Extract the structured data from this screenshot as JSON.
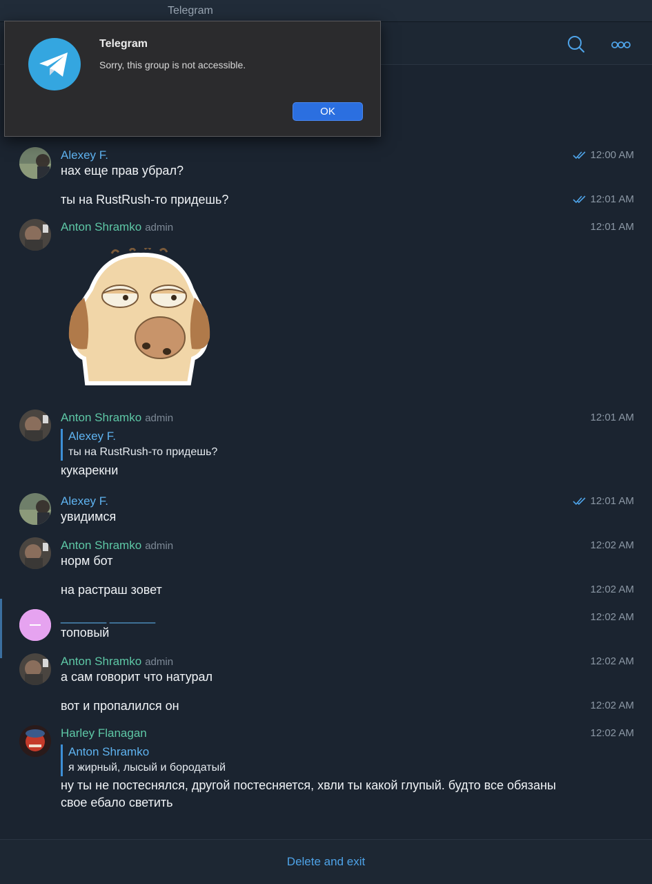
{
  "window": {
    "title": "Telegram"
  },
  "dialog": {
    "title": "Telegram",
    "message": "Sorry, this group is not accessible.",
    "ok_label": "OK"
  },
  "messages": [
    {
      "author": "Alexey F.",
      "text": "нах еще прав убрал?",
      "time": "12:00 AM",
      "read": true
    },
    {
      "text": "ты на RustRush-то придешь?",
      "time": "12:01 AM",
      "read": true
    },
    {
      "author": "Anton Shramko",
      "badge": "admin",
      "time": "12:01 AM",
      "sticker": "dog-sticker"
    },
    {
      "author": "Anton Shramko",
      "badge": "admin",
      "time": "12:01 AM",
      "reply": {
        "author": "Alexey F.",
        "text": "ты на RustRush-то придешь?"
      },
      "text": "кукарекни"
    },
    {
      "author": "Alexey F.",
      "text": "увидимся",
      "time": "12:01 AM",
      "read": true
    },
    {
      "author": "Anton Shramko",
      "badge": "admin",
      "text": "норм бот",
      "time": "12:02 AM"
    },
    {
      "text": "на растраш зовет",
      "time": "12:02 AM"
    },
    {
      "author": "_______ _______",
      "text": "топовый",
      "time": "12:02 AM"
    },
    {
      "author": "Anton Shramko",
      "badge": "admin",
      "text": "а сам говорит что натурал",
      "time": "12:02 AM"
    },
    {
      "text": "вот и пропалился он",
      "time": "12:02 AM"
    },
    {
      "author": "Harley Flanagan",
      "time": "12:02 AM",
      "reply": {
        "author": "Anton Shramko",
        "text": "я жирный, лысый и бородатый"
      },
      "text": "ну ты не постеснялся, другой постесняется, хвли ты какой глупый. будто все обязаны свое ебало светить"
    }
  ],
  "footer": {
    "action_label": "Delete and exit"
  },
  "colors": {
    "accent": "#4ea3e8",
    "background": "#1b2430",
    "name_green": "#5ec8a6",
    "name_blue": "#5fb3f0"
  },
  "icons": [
    "search-icon",
    "more-icon",
    "telegram-logo-icon",
    "double-check-icon"
  ]
}
